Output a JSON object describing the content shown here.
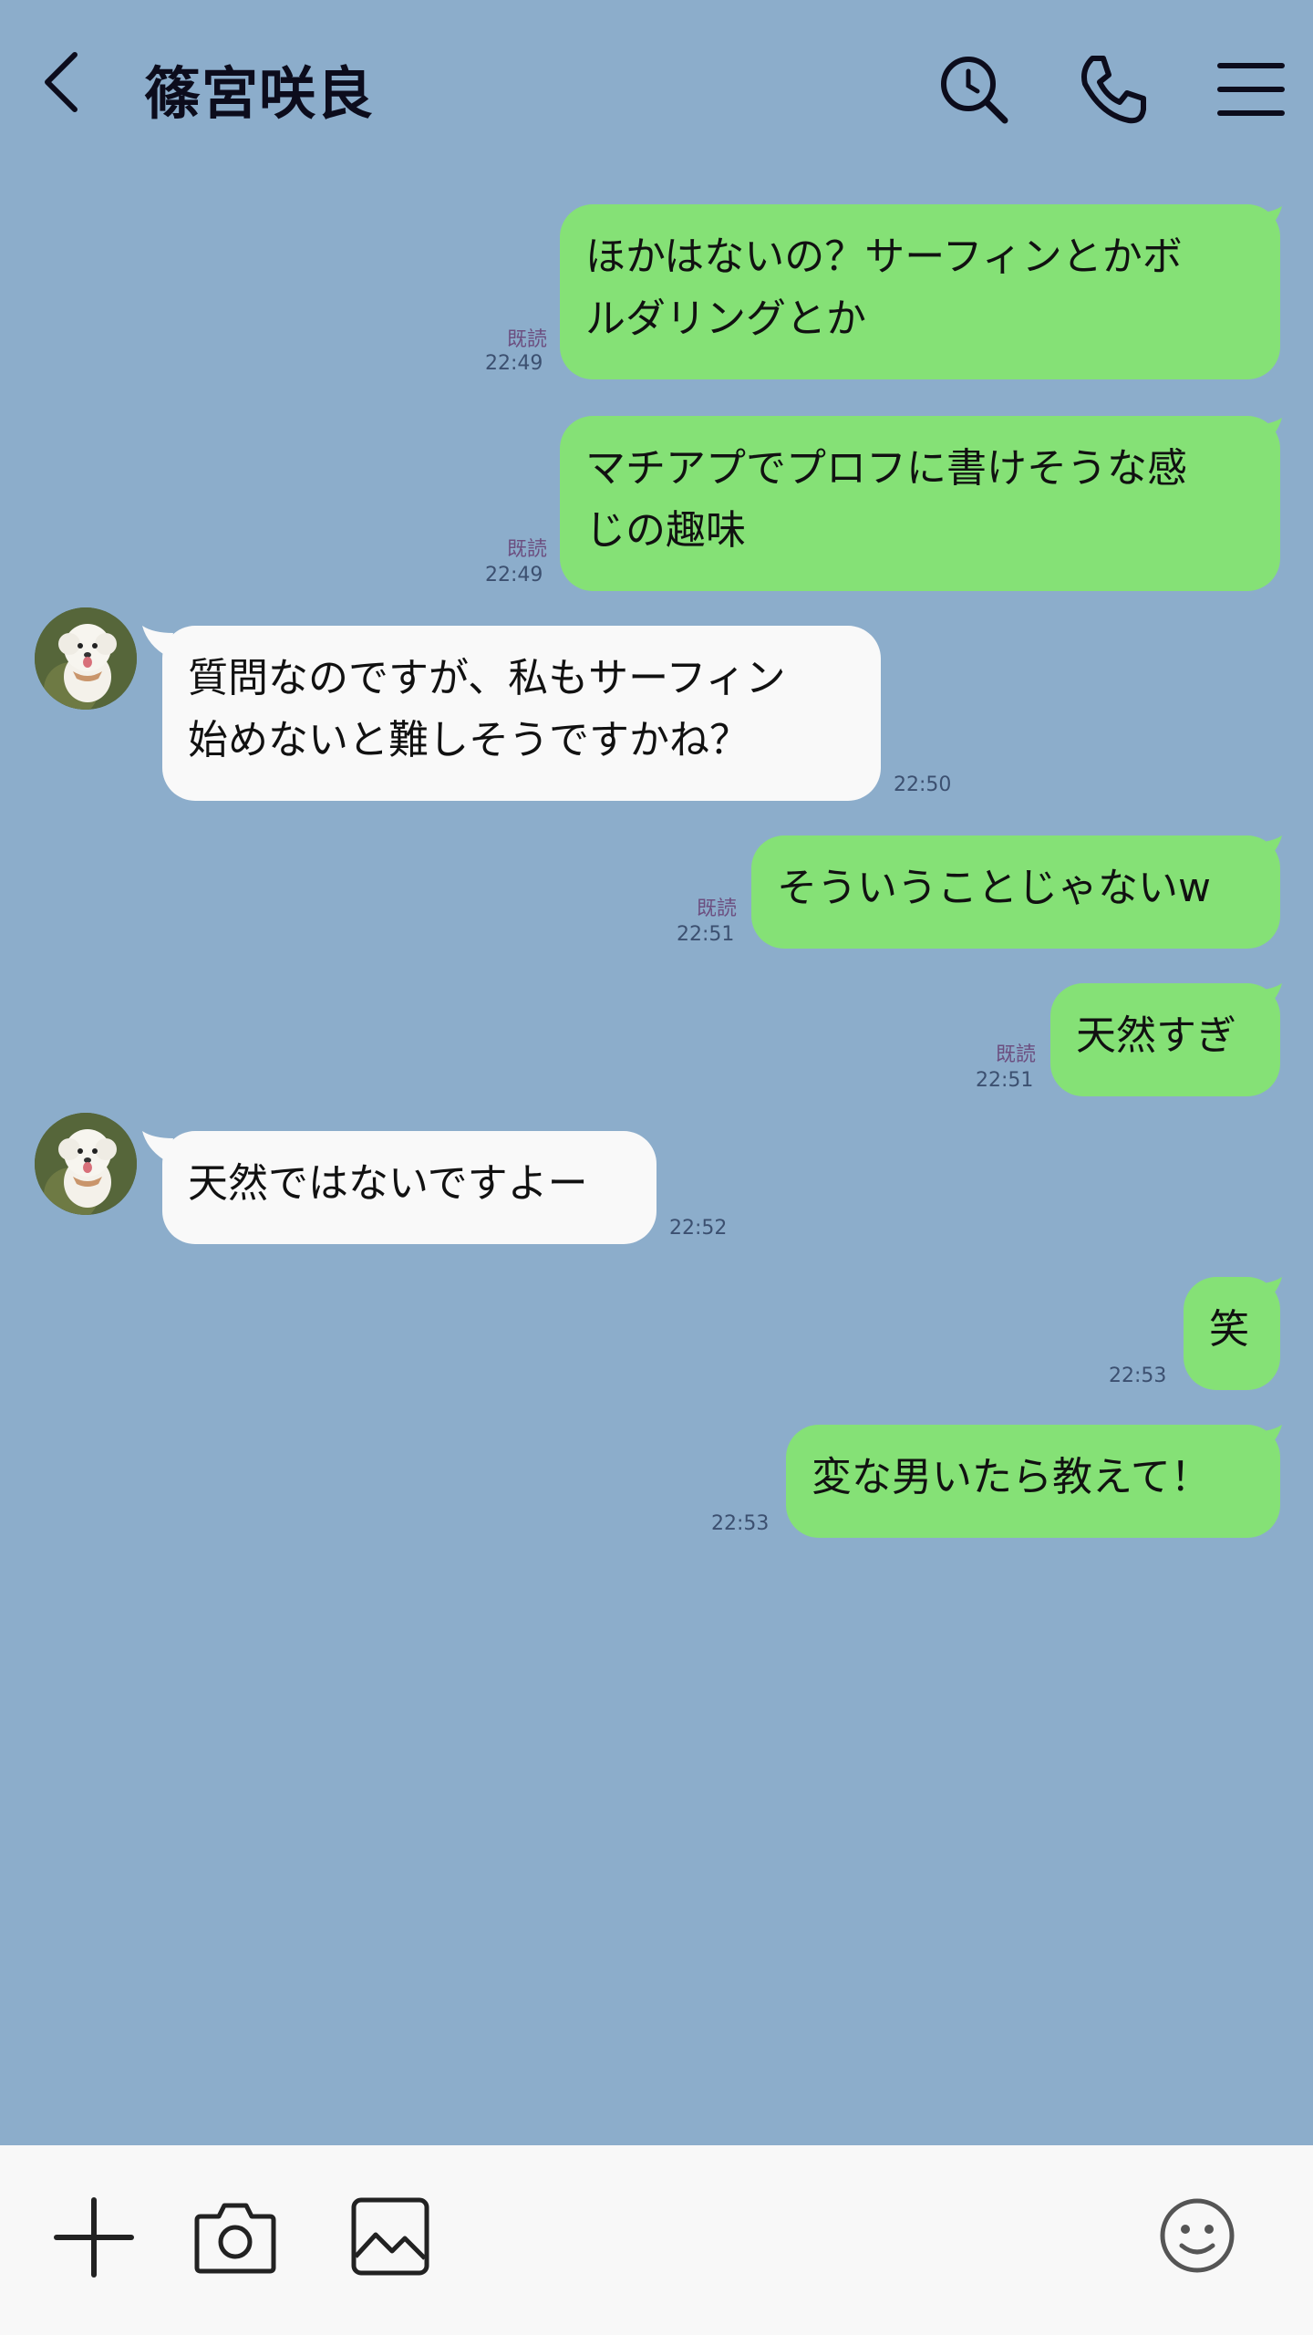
{
  "header": {
    "back_icon": "chevron-left-icon",
    "title": "篠宮咲良",
    "icons": [
      "search-icon",
      "phone-icon",
      "menu-icon"
    ]
  },
  "colors": {
    "background": "#8cadcb",
    "outgoing_bubble": "#85e176",
    "incoming_bubble": "#f9f9f9",
    "read_text": "#6c4f80",
    "footer": "#f8f8f8"
  },
  "messages": [
    {
      "direction": "out",
      "lines": [
        "ほかはないの？サーフィンとかボ",
        "ルダリングとか"
      ],
      "read": "既読",
      "time": "22:49"
    },
    {
      "direction": "out",
      "lines": [
        "マチアプでプロフに書けそうな感",
        "じの趣味"
      ],
      "read": "既読",
      "time": "22:49"
    },
    {
      "direction": "in",
      "lines": [
        "質問なのですが、私もサーフィン",
        "始めないと難しそうですかね？"
      ],
      "time": "22:50"
    },
    {
      "direction": "out",
      "lines": [
        "そういうことじゃないw"
      ],
      "read": "既読",
      "time": "22:51"
    },
    {
      "direction": "out",
      "lines": [
        "天然すぎ"
      ],
      "read": "既読",
      "time": "22:51"
    },
    {
      "direction": "in",
      "lines": [
        "天然ではないですよー"
      ],
      "time": "22:52"
    },
    {
      "direction": "out",
      "lines": [
        "笑"
      ],
      "time": "22:53"
    },
    {
      "direction": "out",
      "lines": [
        "変な男いたら教えて！"
      ],
      "time": "22:53"
    }
  ],
  "footer": {
    "icons": [
      "plus-icon",
      "camera-icon",
      "image-icon",
      "emoji-icon"
    ]
  }
}
